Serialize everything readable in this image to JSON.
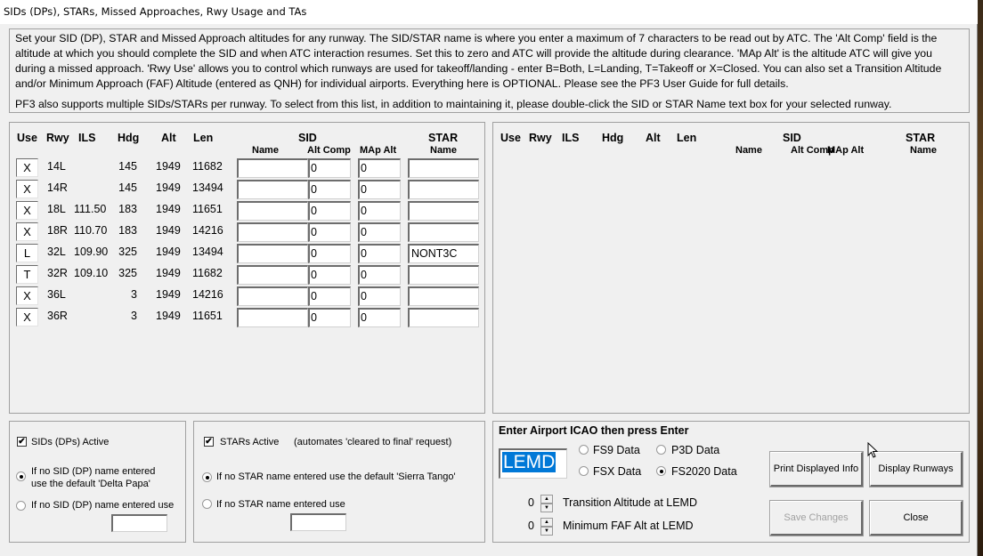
{
  "window": {
    "title": "SIDs (DPs), STARs, Missed Approaches, Rwy Usage and TAs"
  },
  "intro": {
    "paragraph1": "Set your SID (DP), STAR and Missed Approach altitudes for any runway. The SID/STAR name is where you enter a maximum of 7 characters to be read out by ATC. The 'Alt Comp' field is the altitude at which you should complete the SID and when ATC interaction resumes. Set this to zero and ATC will provide the altitude during clearance. 'MAp Alt' is the altitude ATC will give you during a missed approach. 'Rwy Use' allows you to control which runways are used for takeoff/landing - enter B=Both, L=Landing, T=Takeoff or X=Closed.  You can also set a Transition Altitude and/or Minimum Approach (FAF) Altitude (entered as QNH) for individual airports. Everything here is OPTIONAL. Please see the PF3 User Guide for full details.",
    "paragraph2": "PF3 also supports multiple SIDs/STARs per runway. To select from this list, in addition to maintaining it, please double-click the SID or STAR Name text box for your selected runway."
  },
  "table_headers": {
    "use": "Use",
    "rwy": "Rwy",
    "ils": "ILS",
    "hdg": "Hdg",
    "alt": "Alt",
    "len": "Len",
    "sid": "SID",
    "star": "STAR",
    "sid_name": "Name",
    "alt_comp": "Alt Comp",
    "map_alt": "MAp Alt",
    "star_name": "Name"
  },
  "runways": [
    {
      "use": "X",
      "rwy": "14L",
      "ils": "",
      "hdg": "145",
      "alt": "1949",
      "len": "11682",
      "sid_name": "",
      "alt_comp": "0",
      "map_alt": "0",
      "star_name": ""
    },
    {
      "use": "X",
      "rwy": "14R",
      "ils": "",
      "hdg": "145",
      "alt": "1949",
      "len": "13494",
      "sid_name": "",
      "alt_comp": "0",
      "map_alt": "0",
      "star_name": ""
    },
    {
      "use": "X",
      "rwy": "18L",
      "ils": "111.50",
      "hdg": "183",
      "alt": "1949",
      "len": "11651",
      "sid_name": "",
      "alt_comp": "0",
      "map_alt": "0",
      "star_name": ""
    },
    {
      "use": "X",
      "rwy": "18R",
      "ils": "110.70",
      "hdg": "183",
      "alt": "1949",
      "len": "14216",
      "sid_name": "",
      "alt_comp": "0",
      "map_alt": "0",
      "star_name": ""
    },
    {
      "use": "L",
      "rwy": "32L",
      "ils": "109.90",
      "hdg": "325",
      "alt": "1949",
      "len": "13494",
      "sid_name": "",
      "alt_comp": "0",
      "map_alt": "0",
      "star_name": "NONT3C"
    },
    {
      "use": "T",
      "rwy": "32R",
      "ils": "109.10",
      "hdg": "325",
      "alt": "1949",
      "len": "11682",
      "sid_name": "",
      "alt_comp": "0",
      "map_alt": "0",
      "star_name": ""
    },
    {
      "use": "X",
      "rwy": "36L",
      "ils": "",
      "hdg": "3",
      "alt": "1949",
      "len": "14216",
      "sid_name": "",
      "alt_comp": "0",
      "map_alt": "0",
      "star_name": ""
    },
    {
      "use": "X",
      "rwy": "36R",
      "ils": "",
      "hdg": "3",
      "alt": "1949",
      "len": "11651",
      "sid_name": "",
      "alt_comp": "0",
      "map_alt": "0",
      "star_name": ""
    }
  ],
  "sid_panel": {
    "active_label": "SIDs (DPs) Active",
    "active_checked": true,
    "option_default_label_line1": "If no SID (DP) name entered",
    "option_default_label_line2": "use the default 'Delta Papa'",
    "option_custom_label": "If no SID (DP) name entered use",
    "selected_option": "default",
    "custom_value": ""
  },
  "star_panel": {
    "active_label": "STARs Active",
    "active_note": "(automates 'cleared to final' request)",
    "active_checked": true,
    "option_default_label": "If no STAR name entered use the default 'Sierra Tango'",
    "option_custom_label": "If no STAR name entered use",
    "selected_option": "default",
    "custom_value": ""
  },
  "airport_panel": {
    "heading": "Enter Airport ICAO then press Enter",
    "icao_value": "LEMD",
    "data_sources": [
      "FS9 Data",
      "P3D Data",
      "FSX Data",
      "FS2020 Data"
    ],
    "selected_source": "FS2020 Data",
    "transition_altitude_value": "0",
    "transition_altitude_label": "Transition Altitude at LEMD",
    "min_faf_value": "0",
    "min_faf_label": "Minimum FAF Alt at LEMD",
    "buttons": {
      "print": "Print Displayed Info",
      "display_runways": "Display Runways",
      "save_changes": "Save Changes",
      "close": "Close"
    }
  },
  "icons": {
    "checkbox_checked": "✔",
    "spin_up": "▲",
    "spin_down": "▼"
  }
}
